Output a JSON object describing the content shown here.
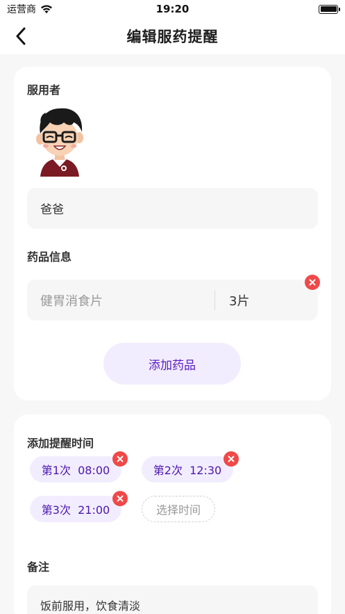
{
  "status_bar": {
    "carrier": "运营商",
    "time": "19:20"
  },
  "nav": {
    "title": "编辑服药提醒"
  },
  "user_section": {
    "label": "服用者",
    "name_value": "爸爸"
  },
  "medicine_section": {
    "label": "药品信息",
    "medicines": [
      {
        "name": "健胃消食片",
        "dose": "3片"
      }
    ],
    "add_button": "添加药品"
  },
  "reminder_section": {
    "label": "添加提醒时间",
    "times": [
      {
        "label": "第1次  08:00"
      },
      {
        "label": "第2次  12:30"
      },
      {
        "label": "第3次  21:00"
      }
    ],
    "select_time": "选择时间"
  },
  "note_section": {
    "label": "备注",
    "value": "饭前服用，饮食清淡"
  },
  "colors": {
    "accent": "#5b1bc0",
    "chip_bg": "#f2edfe",
    "delete_red": "#f04848",
    "page_bg": "#f7f7f7"
  }
}
